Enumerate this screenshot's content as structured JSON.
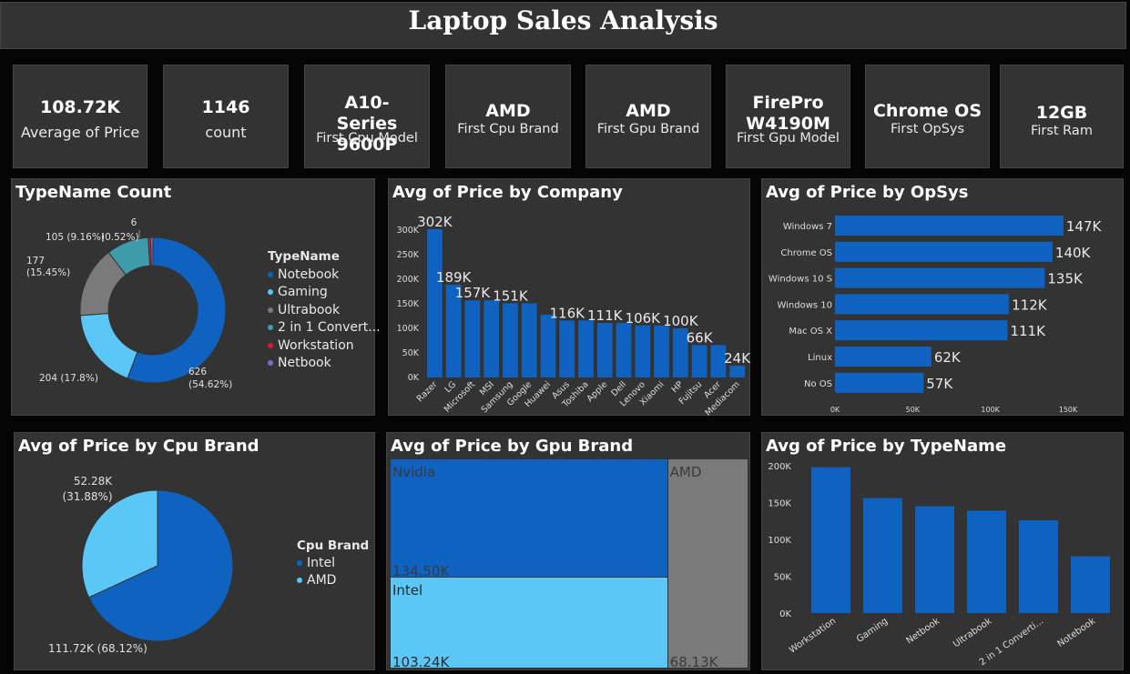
{
  "title": "Laptop Sales Analysis",
  "cards": [
    {
      "value": "108.72K",
      "label": "Average of Price"
    },
    {
      "value": "1146",
      "label": "count"
    },
    {
      "value": "A10-Series 9600P",
      "label": "First Cpu Model"
    },
    {
      "value": "AMD",
      "label": "First Cpu Brand"
    },
    {
      "value": "AMD",
      "label": "First Gpu Brand"
    },
    {
      "value": "FirePro W4190M",
      "label": "First Gpu Model"
    },
    {
      "value": "Chrome OS",
      "label": "First OpSys"
    },
    {
      "value": "12GB",
      "label": "First Ram"
    }
  ],
  "colors": {
    "dark_blue": "#0F62C0",
    "light_blue": "#5BC7F7",
    "gray": "#7A7A7A",
    "teal": "#3E9BAA",
    "red": "#D81B2B",
    "purple": "#7B6FC4",
    "panel_bg": "#333333"
  },
  "chart_data": [
    {
      "id": "typename-count",
      "type": "pie",
      "title": "TypeName Count",
      "legend_title": "TypeName",
      "legend_position": "right",
      "slices": [
        {
          "name": "Notebook",
          "value": 626,
          "label": "626\n(54.62%)"
        },
        {
          "name": "Gaming",
          "value": 204,
          "label": "204 (17.8%)"
        },
        {
          "name": "Ultrabook",
          "value": 177,
          "label": "177\n(15.45%)"
        },
        {
          "name": "2 in 1 Convert...",
          "value": 105,
          "label": "105 (9.16%)"
        },
        {
          "name": "Workstation",
          "value": 6,
          "label": "(0.52%)"
        },
        {
          "name": "Netbook",
          "value": 6,
          "label": "6"
        }
      ],
      "slice_labels": [
        "626",
        "(54.62%)",
        "204 (17.8%)",
        "177",
        "(15.45%)",
        "105 (9.16%)",
        "(0.52%)",
        "6"
      ]
    },
    {
      "id": "price-by-company",
      "type": "bar",
      "title": "Avg of Price by Company",
      "categories": [
        "Razer",
        "LG",
        "Microsoft",
        "MSI",
        "Samsung",
        "Google",
        "Huawei",
        "Asus",
        "Toshiba",
        "Apple",
        "Dell",
        "Lenovo",
        "Xiaomi",
        "HP",
        "Fujitsu",
        "Acer",
        "Mediacom"
      ],
      "values": [
        302000,
        189000,
        157000,
        157000,
        151000,
        151000,
        128000,
        116000,
        116000,
        111000,
        111000,
        106000,
        106000,
        100000,
        66000,
        66000,
        24000
      ],
      "data_labels": [
        "302K",
        "189K",
        "157K",
        "",
        "151K",
        "",
        "",
        "116K",
        "",
        "111K",
        "",
        "106K",
        "",
        "100K",
        "66K",
        "",
        "24K"
      ],
      "ylim": [
        0,
        300000
      ],
      "yticks": [
        "0K",
        "50K",
        "100K",
        "150K",
        "200K",
        "250K",
        "300K"
      ],
      "grid": false
    },
    {
      "id": "price-by-opsys",
      "type": "bar",
      "orientation": "horizontal",
      "title": "Avg of Price by OpSys",
      "categories": [
        "Windows 7",
        "Chrome OS",
        "Windows 10 S",
        "Windows 10",
        "Mac OS X",
        "Linux",
        "No OS"
      ],
      "values": [
        147000,
        140000,
        135000,
        112000,
        111000,
        62000,
        57000
      ],
      "data_labels": [
        "147K",
        "140K",
        "135K",
        "112K",
        "111K",
        "62K",
        "57K"
      ],
      "xlim": [
        0,
        150000
      ],
      "xticks": [
        "0K",
        "50K",
        "100K",
        "150K"
      ]
    },
    {
      "id": "price-by-cpu-brand",
      "type": "pie",
      "title": "Avg of Price by Cpu Brand",
      "legend_title": "Cpu Brand",
      "legend_position": "right",
      "slices": [
        {
          "name": "Intel",
          "value": 111.72,
          "label": "111.72K (68.12%)"
        },
        {
          "name": "AMD",
          "value": 52.28,
          "label": "52.28K (31.88%)"
        }
      ],
      "slice_labels": [
        "52.28K",
        "(31.88%)",
        "111.72K (68.12%)"
      ]
    },
    {
      "id": "price-by-gpu-brand",
      "type": "treemap",
      "title": "Avg of Price by Gpu Brand",
      "cells": [
        {
          "name": "Nvidia",
          "value": 134.5,
          "label": "134.50K"
        },
        {
          "name": "Intel",
          "value": 103.24,
          "label": "103.24K"
        },
        {
          "name": "AMD",
          "value": 68.13,
          "label": "68.13K"
        }
      ]
    },
    {
      "id": "price-by-typename",
      "type": "bar",
      "title": "Avg of Price by TypeName",
      "categories": [
        "Workstation",
        "Gaming",
        "Netbook",
        "Ultrabook",
        "2 in 1 Converti...",
        "Notebook"
      ],
      "values": [
        198000,
        156000,
        145000,
        139000,
        126000,
        77000
      ],
      "ylim": [
        0,
        200000
      ],
      "yticks": [
        "0K",
        "50K",
        "100K",
        "150K",
        "200K"
      ]
    }
  ]
}
